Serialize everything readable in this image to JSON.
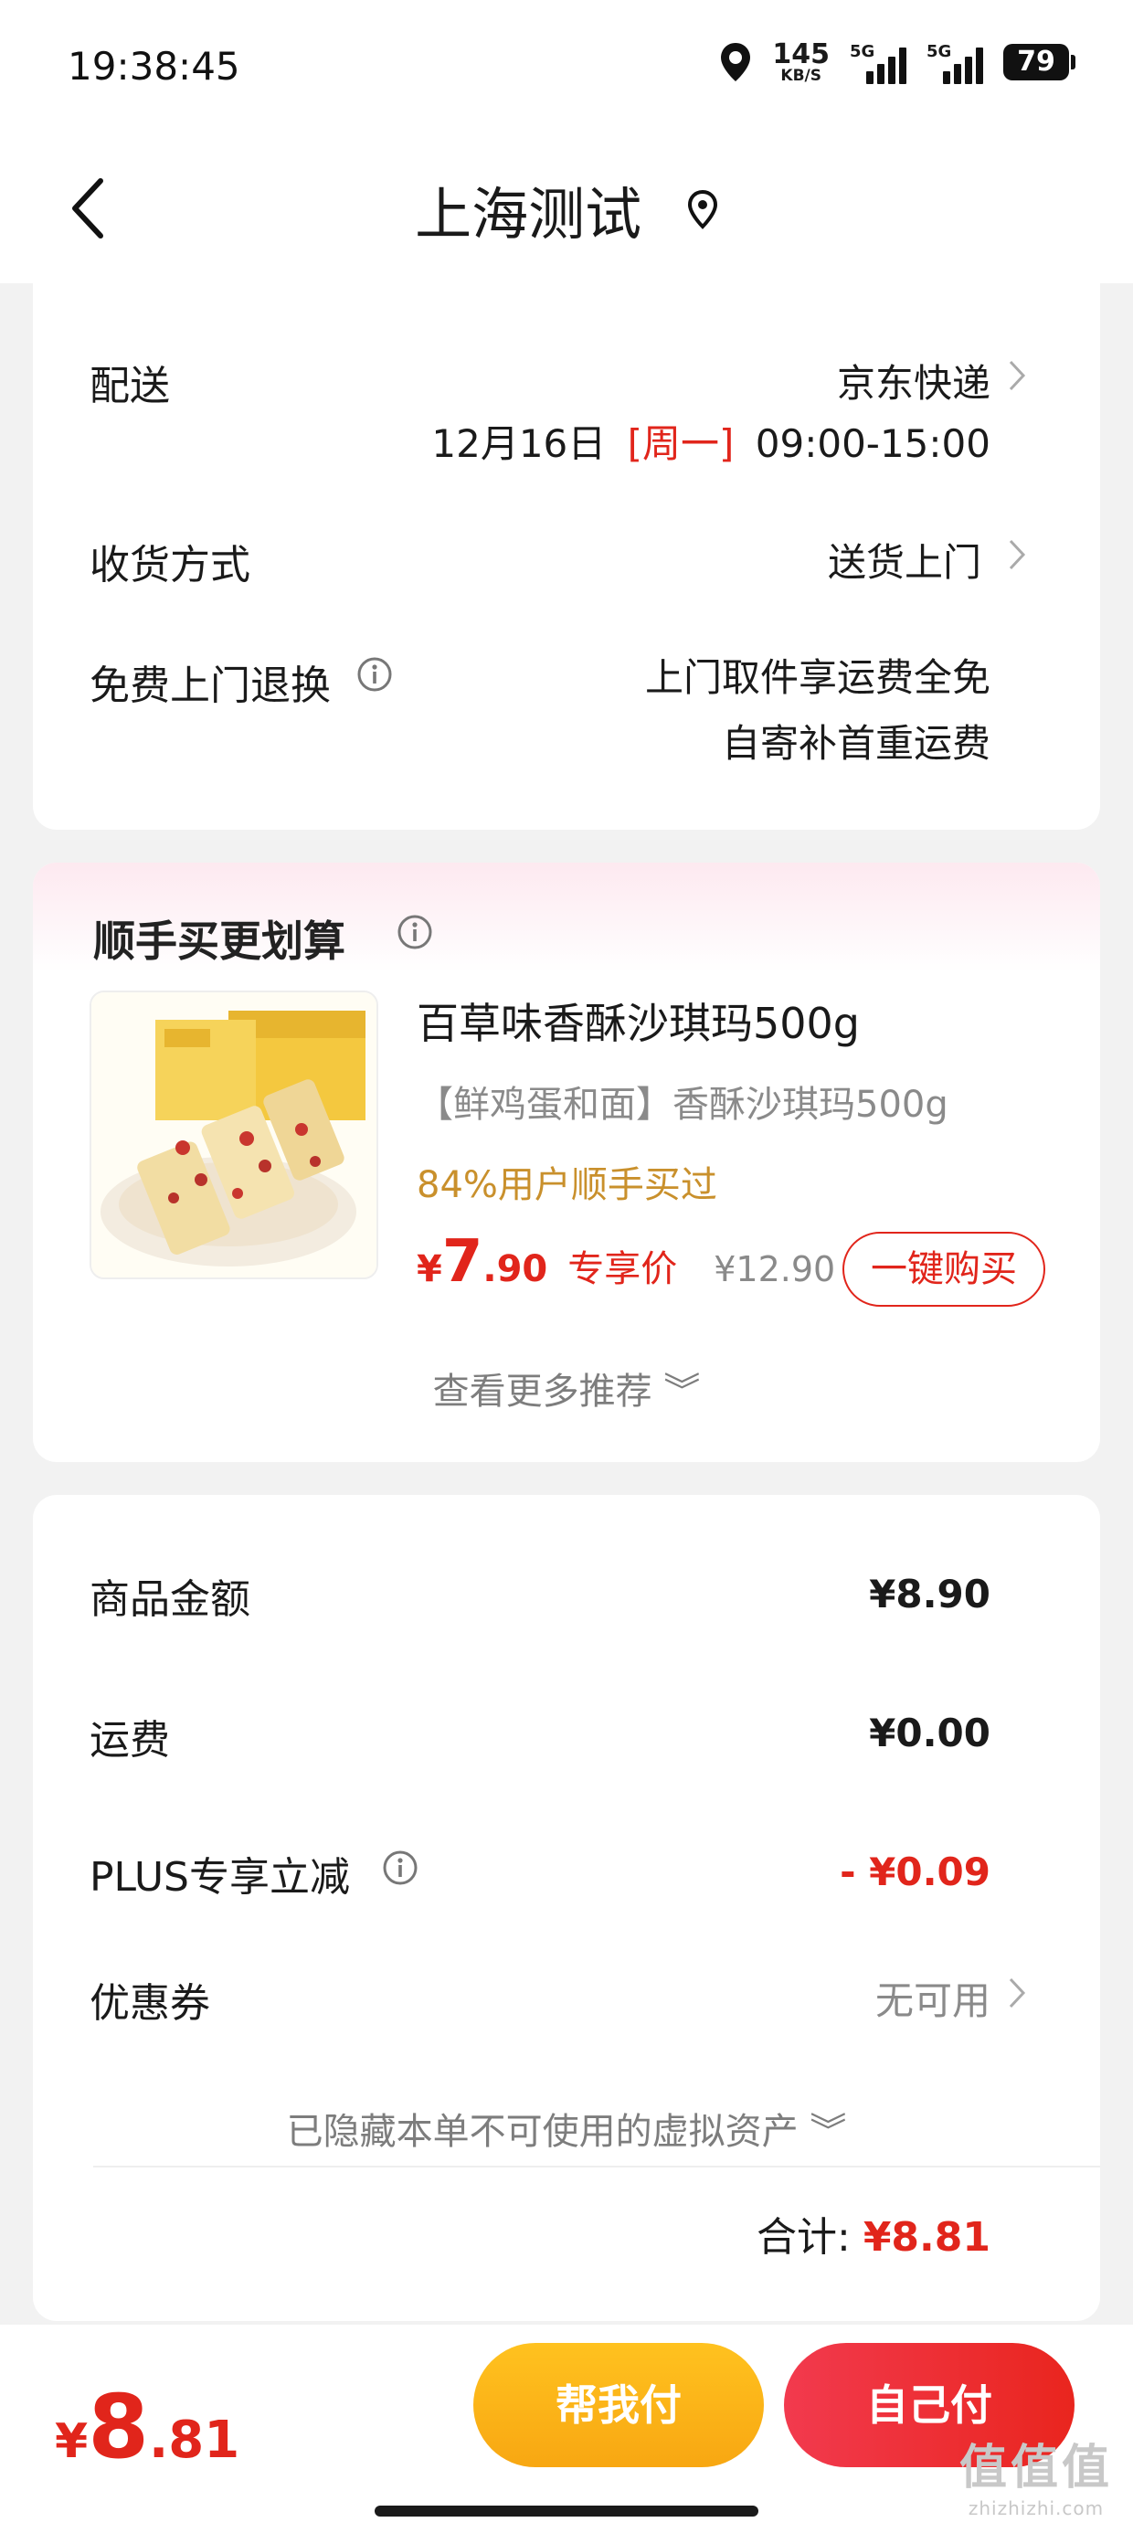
{
  "status": {
    "time": "19:38:45",
    "net_speed_value": "145",
    "net_speed_unit": "KB/S",
    "signal_label_1": "5G",
    "signal_label_2": "5G",
    "battery": "79"
  },
  "nav": {
    "title": "上海测试"
  },
  "delivery": {
    "delivery_label": "配送",
    "delivery_carrier": "京东快递",
    "delivery_date": "12月16日",
    "delivery_weekday": "[周一]",
    "delivery_time": "09:00-15:00",
    "receive_label": "收货方式",
    "receive_value": "送货上门",
    "return_label": "免费上门退换",
    "return_line1": "上门取件享运费全免",
    "return_line2": "自寄补首重运费"
  },
  "upsell": {
    "title": "顺手买更划算",
    "product": {
      "name": "百草味香酥沙琪玛500g",
      "desc": "【鲜鸡蛋和面】香酥沙琪玛500g",
      "social": "84%用户顺手买过",
      "price_symbol": "¥",
      "price_int": "7",
      "price_dec": ".90",
      "price_tag": "专享价",
      "orig_price": "¥12.90",
      "buy_label": "一键购买"
    },
    "more_label": "查看更多推荐 ︾"
  },
  "fees": {
    "goods_label": "商品金额",
    "goods_value": "¥8.90",
    "shipping_label": "运费",
    "shipping_value": "¥0.00",
    "plus_label": "PLUS专享立减",
    "plus_value": "- ¥0.09",
    "coupon_label": "优惠券",
    "coupon_value": "无可用",
    "hidden_label": "已隐藏本单不可使用的虚拟资产 ︾",
    "total_label": "合计:",
    "total_value": "¥8.81"
  },
  "bottom": {
    "price_symbol": "¥",
    "price_int": "8",
    "price_dec": ".81",
    "friend_pay_label": "帮我付",
    "self_pay_label": "自己付"
  },
  "watermark": {
    "big": "值值值",
    "small": "zhizhizhi.com"
  },
  "colors": {
    "accent_red": "#e1251b",
    "gold": "#c9902c",
    "friend_pay": "#f8a712"
  }
}
